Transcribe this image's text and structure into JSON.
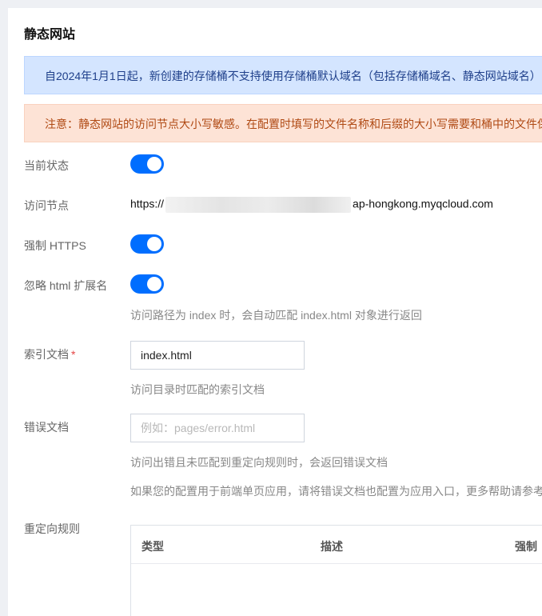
{
  "section": {
    "title": "静态网站"
  },
  "alerts": {
    "info": "自2024年1月1日起，新创建的存储桶不支持使用存储桶默认域名（包括存储桶域名、静态网站域名）",
    "warn": "注意：静态网站的访问节点大小写敏感。在配置时填写的文件名称和后缀的大小写需要和桶中的文件保持一致。"
  },
  "form": {
    "status_label": "当前状态",
    "endpoint_label": "访问节点",
    "endpoint_prefix": "https://",
    "endpoint_suffix": "ap-hongkong.myqcloud.com",
    "force_https_label": "强制 HTTPS",
    "ignore_html_label": "忽略 html 扩展名",
    "ignore_html_help": "访问路径为 index 时，会自动匹配 index.html 对象进行返回",
    "index_label": "索引文档",
    "index_required": "*",
    "index_value": "index.html",
    "index_help": "访问目录时匹配的索引文档",
    "error_label": "错误文档",
    "error_placeholder": "例如：pages/error.html",
    "error_help1": "访问出错且未匹配到重定向规则时，会返回错误文档",
    "error_help2": "如果您的配置用于前端单页应用，请将错误文档也配置为应用入口，更多帮助请参考",
    "redirect_label": "重定向规则"
  },
  "toggles": {
    "status": true,
    "force_https": true,
    "ignore_html": true
  },
  "rules_table": {
    "col_type": "类型",
    "col_desc": "描述",
    "col_force": "强制"
  },
  "colors": {
    "accent": "#006eff",
    "info_bg": "#d4e5ff",
    "warn_bg": "#fde3d6"
  }
}
